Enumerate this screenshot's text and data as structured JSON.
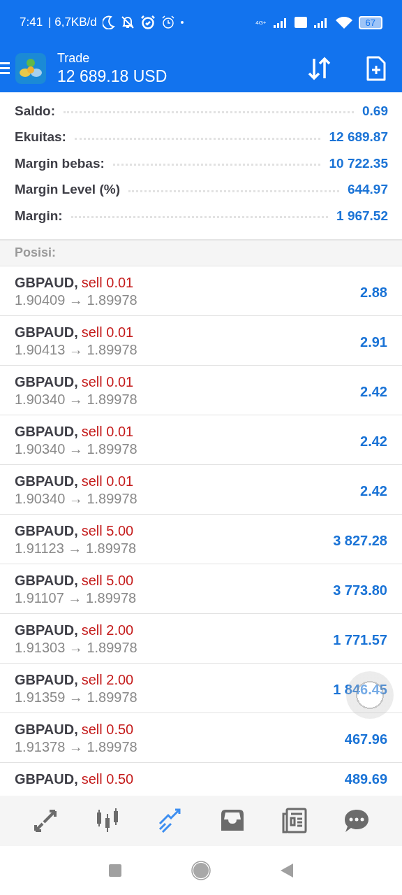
{
  "status_bar": {
    "time": "7:41",
    "speed": "| 6,7KB/d",
    "network": "4G+",
    "battery": "67"
  },
  "header": {
    "title": "Trade",
    "balance": "12 689.18 USD"
  },
  "summary": [
    {
      "label": "Saldo:",
      "value": "0.69"
    },
    {
      "label": "Ekuitas:",
      "value": "12 689.87"
    },
    {
      "label": "Margin bebas:",
      "value": "10 722.35"
    },
    {
      "label": "Margin Level (%)",
      "value": "644.97"
    },
    {
      "label": "Margin:",
      "value": "1 967.52"
    }
  ],
  "positions_title": "Posisi:",
  "positions": [
    {
      "symbol": "GBPAUD,",
      "side": "sell 0.01",
      "prices": "1.90409 → 1.89978",
      "profit": "2.88"
    },
    {
      "symbol": "GBPAUD,",
      "side": "sell 0.01",
      "prices": "1.90413 → 1.89978",
      "profit": "2.91"
    },
    {
      "symbol": "GBPAUD,",
      "side": "sell 0.01",
      "prices": "1.90340 → 1.89978",
      "profit": "2.42"
    },
    {
      "symbol": "GBPAUD,",
      "side": "sell 0.01",
      "prices": "1.90340 → 1.89978",
      "profit": "2.42"
    },
    {
      "symbol": "GBPAUD,",
      "side": "sell 0.01",
      "prices": "1.90340 → 1.89978",
      "profit": "2.42"
    },
    {
      "symbol": "GBPAUD,",
      "side": "sell 5.00",
      "prices": "1.91123 → 1.89978",
      "profit": "3 827.28"
    },
    {
      "symbol": "GBPAUD,",
      "side": "sell 5.00",
      "prices": "1.91107 → 1.89978",
      "profit": "3 773.80"
    },
    {
      "symbol": "GBPAUD,",
      "side": "sell 2.00",
      "prices": "1.91303 → 1.89978",
      "profit": "1 771.57"
    },
    {
      "symbol": "GBPAUD,",
      "side": "sell 2.00",
      "prices": "1.91359 → 1.89978",
      "profit": "1 846.45"
    },
    {
      "symbol": "GBPAUD,",
      "side": "sell 0.50",
      "prices": "1.91378 → 1.89978",
      "profit": "467.96"
    },
    {
      "symbol": "GBPAUD,",
      "side": "sell 0.50",
      "profit": "489.69"
    }
  ],
  "bottom_nav": [
    {
      "kind": "quotes",
      "selected": false
    },
    {
      "kind": "chart",
      "selected": false
    },
    {
      "kind": "trade",
      "selected": true
    },
    {
      "kind": "history",
      "selected": false
    },
    {
      "kind": "news",
      "selected": false
    },
    {
      "kind": "chat",
      "selected": false
    }
  ]
}
